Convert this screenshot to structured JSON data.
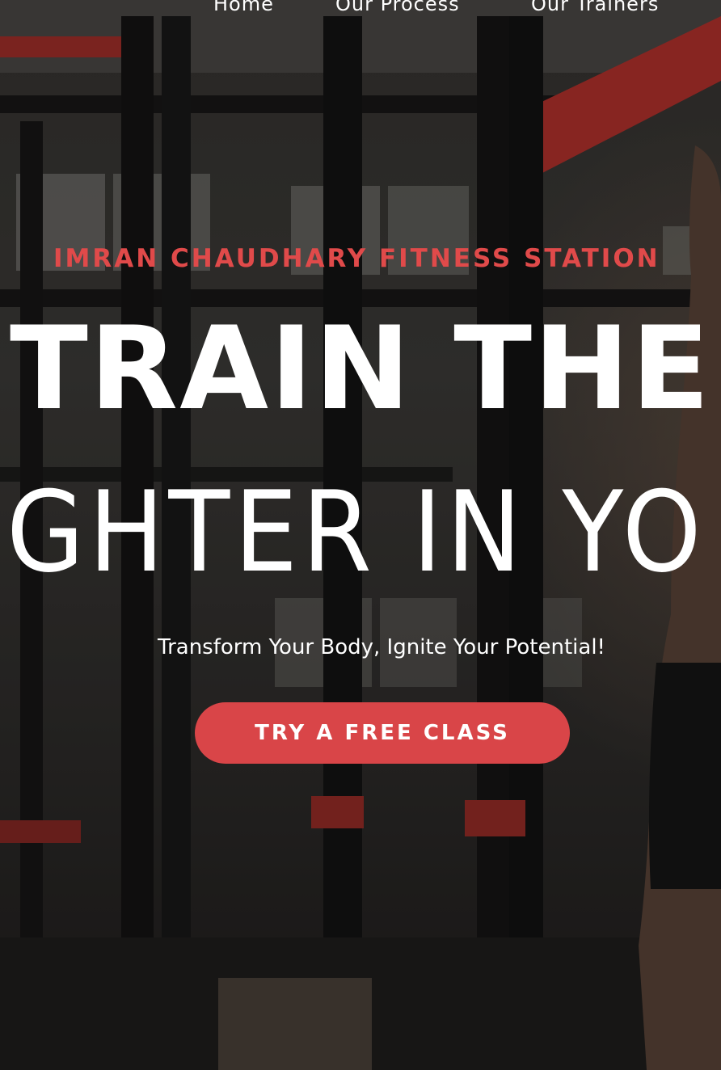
{
  "nav": {
    "items": [
      {
        "label": "Home"
      },
      {
        "label": "Our Process"
      },
      {
        "label": "Our Trainers"
      }
    ]
  },
  "hero": {
    "eyebrow": "IMRAN CHAUDHARY FITNESS STATION",
    "headline_line1": "TRAIN THE",
    "headline_line2": "GHTER IN YO",
    "tagline": "Transform Your Body, Ignite Your Potential!",
    "cta_label": "TRY A FREE CLASS"
  },
  "colors": {
    "accent": "#d94548",
    "eyebrow": "#e04a4a",
    "text": "#ffffff"
  }
}
